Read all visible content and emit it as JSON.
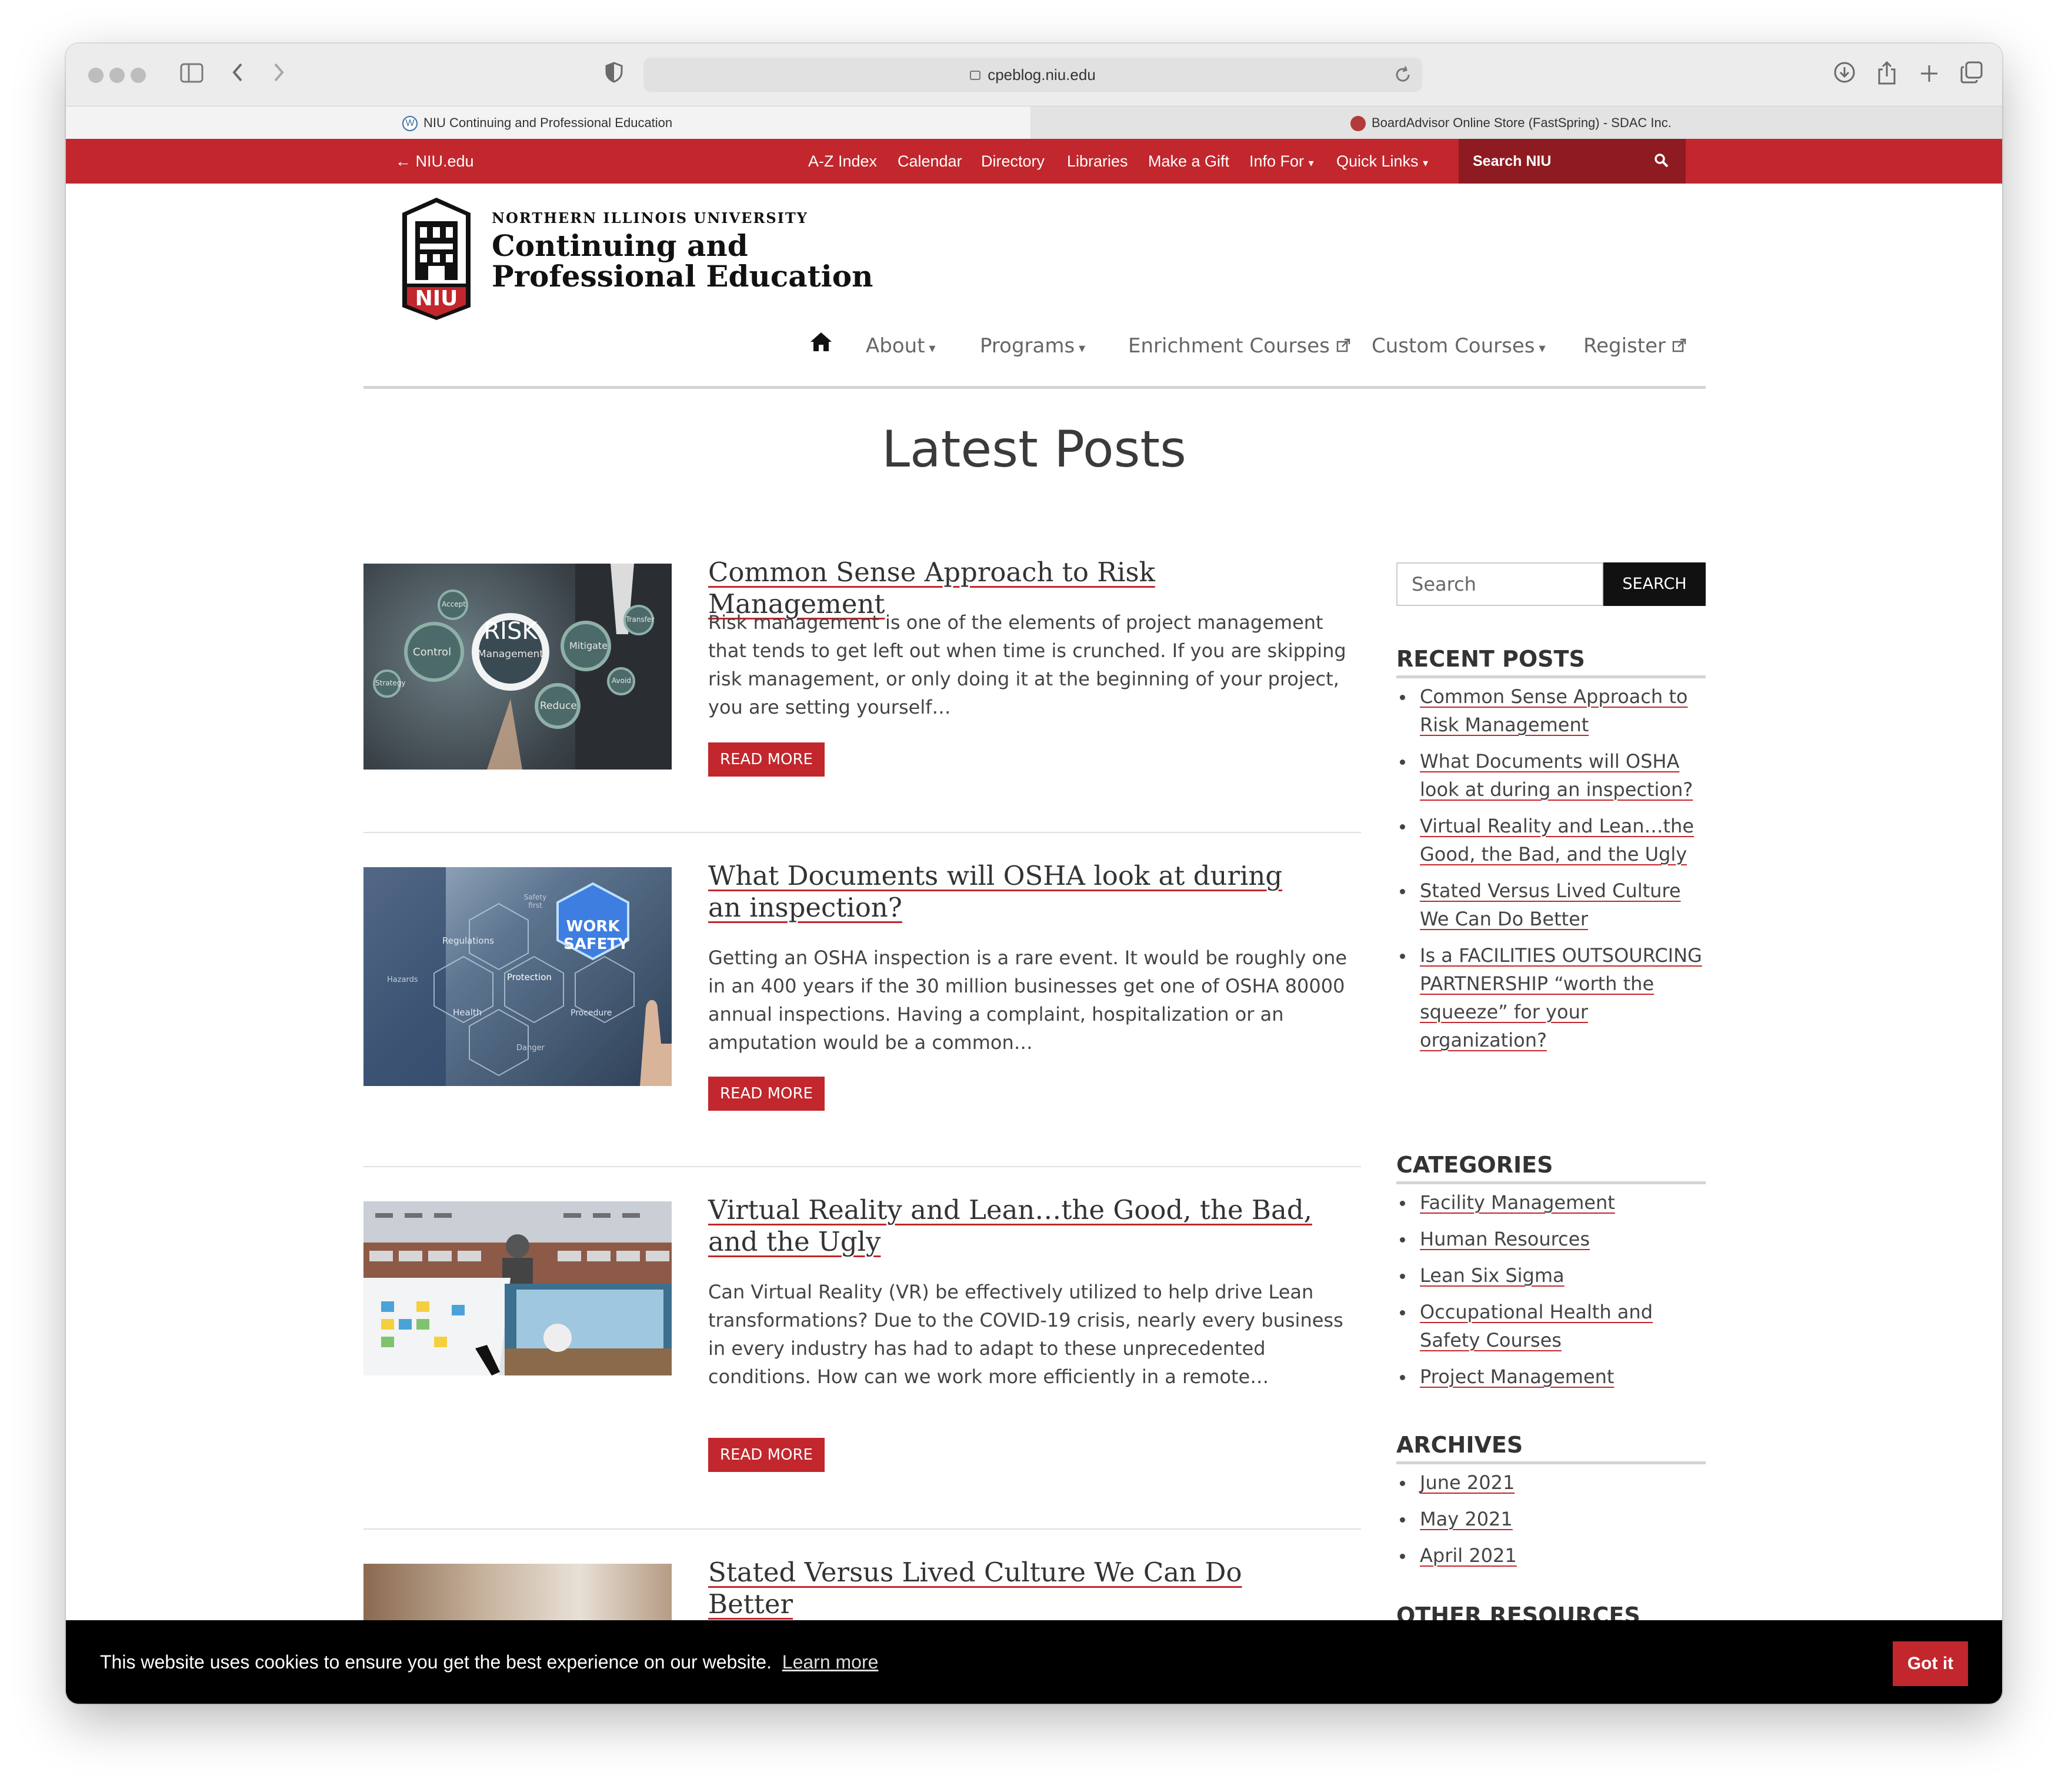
{
  "browser": {
    "url": "cpeblog.niu.edu",
    "tabs": [
      {
        "title": "NIU Continuing and Professional Education",
        "active": true
      },
      {
        "title": "BoardAdvisor Online Store (FastSpring) - SDAC Inc.",
        "active": false
      }
    ]
  },
  "topnav": {
    "back": "← NIU.edu",
    "links": [
      "A-Z Index",
      "Calendar",
      "Directory",
      "Libraries",
      "Make a Gift",
      "Info For",
      "Quick Links"
    ],
    "search_label": "Search NIU"
  },
  "header": {
    "university": "NORTHERN ILLINOIS UNIVERSITY",
    "department": "Continuing and Professional Education",
    "logo_text": "NIU"
  },
  "mainnav": {
    "items": [
      "About",
      "Programs",
      "Enrichment Courses",
      "Custom Courses",
      "Register"
    ]
  },
  "page": {
    "title": "Latest Posts"
  },
  "posts": [
    {
      "title": "Common Sense Approach to Risk Management",
      "excerpt": "Risk management is one of the elements of project management that tends to get left out when time is crunched.  If you are skipping risk management, or only doing it at the beginning of your project, you are setting yourself…",
      "read_more": "READ MORE",
      "thumb_words": [
        "RISK",
        "Management",
        "Control",
        "Mitigate",
        "Reduce",
        "Accept",
        "Transfer",
        "Avoid",
        "Strategy"
      ]
    },
    {
      "title": "What Documents will OSHA look at during an inspection?",
      "excerpt": "Getting an OSHA inspection is a rare event.  It would be roughly one in an 400 years if the 30  million businesses get one of OSHA 80000 annual inspections. Having a complaint, hospitalization or an amputation would be a common…",
      "read_more": "READ MORE",
      "thumb_words": [
        "WORK",
        "SAFETY",
        "Regulations",
        "Protection",
        "Health",
        "Procedure",
        "Hazards",
        "Danger",
        "Safety first"
      ]
    },
    {
      "title": "Virtual Reality and Lean…the Good, the Bad, and the Ugly",
      "excerpt": "Can Virtual Reality (VR) be effectively utilized to help drive Lean transformations?  Due to the COVID-19 crisis, nearly every business in every industry has had to adapt to these unprecedented conditions.  How can we work more efficiently in a remote…",
      "read_more": "READ MORE"
    },
    {
      "title": "Stated Versus Lived Culture We Can Do Better"
    }
  ],
  "sidebar": {
    "search_placeholder": "Search",
    "search_button": "SEARCH",
    "recent_heading": "RECENT POSTS",
    "recent": [
      "Common Sense Approach to Risk Management",
      "What Documents will OSHA look at during an inspection?",
      "Virtual Reality and Lean…the Good, the Bad, and the Ugly",
      "Stated Versus Lived Culture We Can Do Better",
      "Is a FACILITIES OUTSOURCING PARTNERSHIP “worth the squeeze” for your organization?"
    ],
    "categories_heading": "CATEGORIES",
    "categories": [
      "Facility Management",
      "Human Resources",
      "Lean Six Sigma",
      "Occupational Health and Safety Courses",
      "Project Management"
    ],
    "archives_heading": "ARCHIVES",
    "archives": [
      "June 2021",
      "May 2021",
      "April 2021"
    ],
    "other_heading": "OTHER RESOURCES"
  },
  "cookie": {
    "message": "This website uses cookies to ensure you get the best experience on our website.",
    "learn_more": "Learn more",
    "button": "Got it"
  },
  "colors": {
    "brand_red": "#c1272d",
    "dark_red": "#8d1b21",
    "text": "#444444"
  }
}
